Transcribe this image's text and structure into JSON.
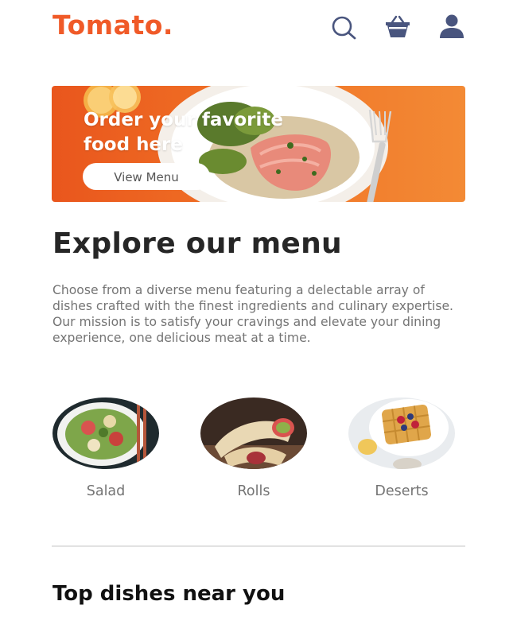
{
  "brand": {
    "logo_text": "Tomato.",
    "accent_color": "#f05a28",
    "icon_color": "#49557e"
  },
  "navbar": {
    "icons": [
      "search-icon",
      "basket-icon",
      "profile-icon"
    ]
  },
  "hero": {
    "title_line1": "Order your favorite",
    "title_line2": "food here",
    "button_label": "View Menu"
  },
  "explore": {
    "heading": "Explore our menu",
    "description": "Choose from a diverse menu featuring a delectable array of dishes crafted with the finest ingredients and culinary expertise. Our mission is to satisfy your cravings and elevate your dining experience, one delicious meat at a time."
  },
  "menu": {
    "items": [
      {
        "label": "Salad"
      },
      {
        "label": "Rolls"
      },
      {
        "label": "Deserts"
      }
    ]
  },
  "top_dishes": {
    "heading": "Top dishes near you"
  }
}
